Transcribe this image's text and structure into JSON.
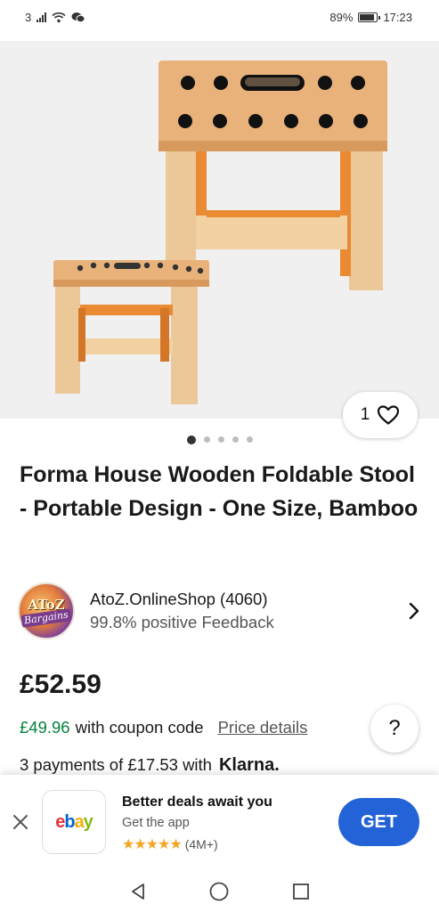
{
  "status_bar": {
    "sim_label": "3",
    "battery_percent": "89%",
    "battery_level": 0.89,
    "time": "17:23",
    "icons": [
      "signal-icon",
      "wifi-icon",
      "wechat-icon",
      "battery-icon"
    ]
  },
  "product": {
    "image_favorite_count": "1",
    "image_count": 5,
    "active_image_index": 0,
    "title": "Forma House Wooden Foldable Stool - Portable Design - One Size, Bamboo"
  },
  "seller": {
    "logo_line1": "AToZ",
    "logo_line2": "Bargains",
    "name": "AtoZ.OnlineShop (4060)",
    "feedback": "99.8% positive Feedback"
  },
  "pricing": {
    "price": "£52.59",
    "coupon_price": "£49.96",
    "coupon_text": "with coupon code",
    "price_details_link": "Price details",
    "help_label": "?",
    "klarna_text": "3 payments of £17.53 with",
    "klarna_brand": "Klarna."
  },
  "app_banner": {
    "app_name": "ebay",
    "title": "Better deals await you",
    "subtitle": "Get the app",
    "stars": "★★★★★",
    "reviews": "(4M+)",
    "rating_value": 5,
    "get_label": "GET"
  },
  "colors": {
    "accent_blue": "#2462d8",
    "coupon_green": "#05823f",
    "star_orange": "#f5a623"
  }
}
